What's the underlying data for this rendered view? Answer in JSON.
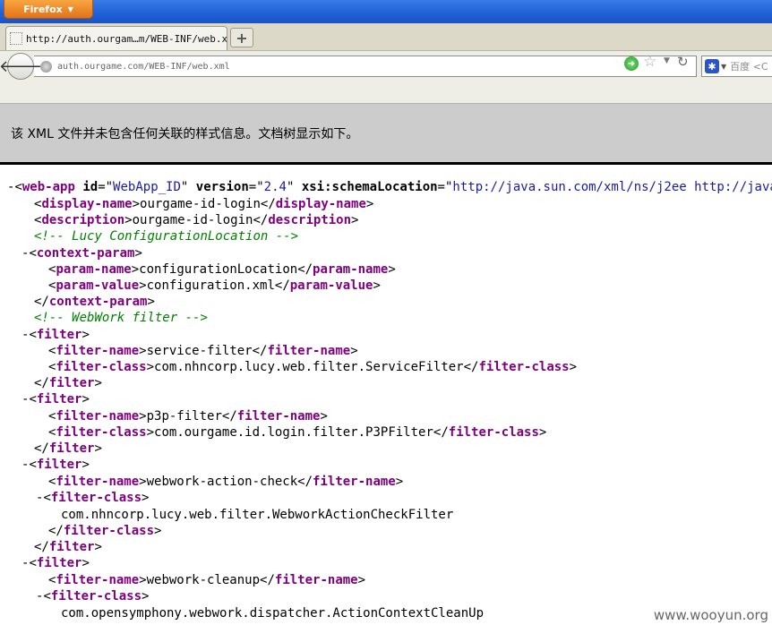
{
  "browser": {
    "app_button": "Firefox",
    "tab_title": "http://auth.ourgam…m/WEB-INF/web.xml",
    "new_tab": "+",
    "url": "auth.ourgame.com/WEB-INF/web.xml",
    "search_placeholder": "百度 <C",
    "icons": [
      "back-icon",
      "globe-icon",
      "go-icon",
      "star-icon",
      "dropdown-icon",
      "reload-icon",
      "search-engine-icon"
    ]
  },
  "banner": {
    "message": "该 XML 文件并未包含任何关联的样式信息。文档树显示如下。"
  },
  "xml": {
    "root_tag": "web-app",
    "root_attrs": [
      {
        "name": "id",
        "value": "WebApp_ID"
      },
      {
        "name": "version",
        "value": "2.4"
      },
      {
        "name": "xsi:schemaLocation",
        "value": "http://java.sun.com/xml/ns/j2ee http://java"
      }
    ],
    "display_name_tag": "display-name",
    "display_name": "ourgame-id-login",
    "description_tag": "description",
    "description": "ourgame-id-login",
    "comment1": "Lucy ConfigurationLocation",
    "context_param_tag": "context-param",
    "param_name_tag": "param-name",
    "param_name": "configurationLocation",
    "param_value_tag": "param-value",
    "param_value": "configuration.xml",
    "comment2": "WebWork filter",
    "filter_tag": "filter",
    "filter_name_tag": "filter-name",
    "filter_class_tag": "filter-class",
    "filters": [
      {
        "name": "service-filter",
        "class": "com.nhncorp.lucy.web.filter.ServiceFilter"
      },
      {
        "name": "p3p-filter",
        "class": "com.ourgame.id.login.filter.P3PFilter"
      },
      {
        "name": "webwork-action-check",
        "class": "com.nhncorp.lucy.web.filter.WebworkActionCheckFilter"
      },
      {
        "name": "webwork-cleanup",
        "class": "com.opensymphony.webwork.dispatcher.ActionContextCleanUp"
      }
    ],
    "collapse_glyph": "-"
  },
  "watermark": "www.wooyun.org"
}
